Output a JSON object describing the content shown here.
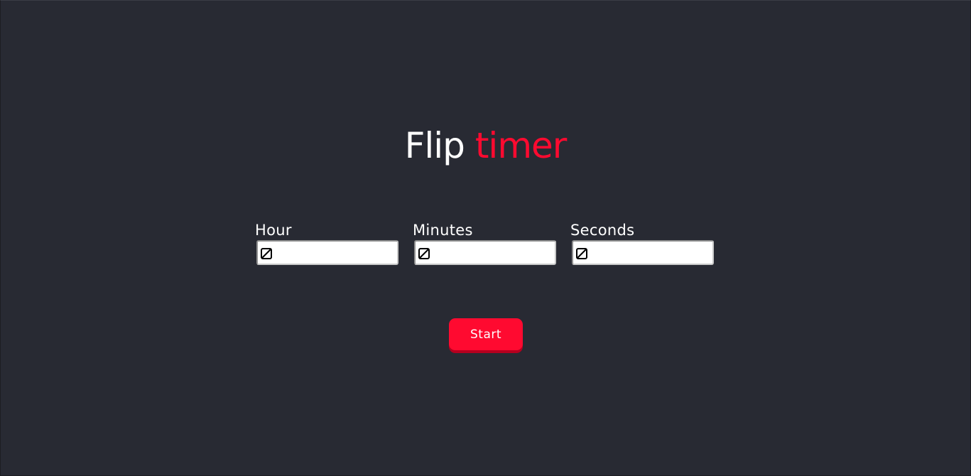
{
  "title": {
    "word1": "Flip",
    "word2": "timer",
    "color_primary": "#ffffff",
    "color_accent": "#ff0a30"
  },
  "fields": [
    {
      "label": "Hour",
      "value": "",
      "icon": "no-symbol-icon"
    },
    {
      "label": "Minutes",
      "value": "",
      "icon": "no-symbol-icon"
    },
    {
      "label": "Seconds",
      "value": "",
      "icon": "no-symbol-icon"
    }
  ],
  "start_button": {
    "label": "Start",
    "color": "#ff0a30"
  },
  "colors": {
    "background": "#282a33"
  }
}
